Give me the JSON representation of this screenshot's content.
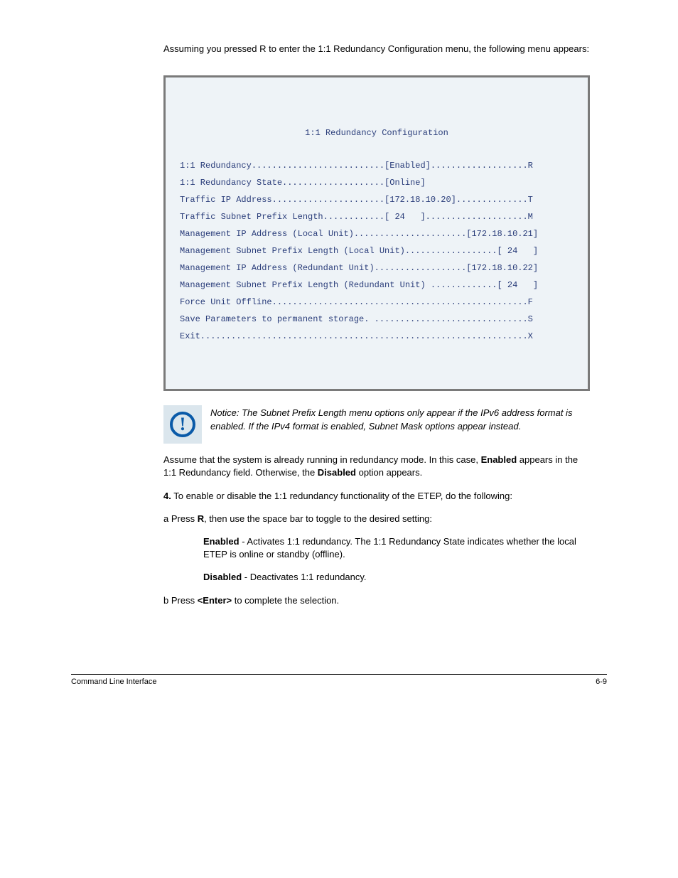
{
  "headerNote": "Assuming you pressed R to enter the 1:1 Redundancy Configuration menu, the following menu appears:",
  "config": {
    "title": "1:1 Redundancy Configuration",
    "lines": [
      "1:1 Redundancy..........................[Enabled]...................R",
      "1:1 Redundancy State....................[Online]",
      "Traffic IP Address......................[172.18.10.20]..............T",
      "Traffic Subnet Prefix Length............[ 24   ]....................M",
      "Management IP Address (Local Unit)......................[172.18.10.21]",
      "Management Subnet Prefix Length (Local Unit)..................[ 24   ]",
      "Management IP Address (Redundant Unit)..................[172.18.10.22]",
      "Management Subnet Prefix Length (Redundant Unit) .............[ 24   ]",
      "Force Unit Offline..................................................F",
      "",
      "Save Parameters to permanent storage. ..............................S",
      "Exit................................................................X"
    ]
  },
  "notice": "Notice: The Subnet Prefix Length menu options only appear if the IPv6 address format is enabled. If the IPv4 format is enabled, Subnet Mask options appear instead.",
  "body": {
    "p1a": "Assume that the system is already running in redundancy mode. In this case, ",
    "p1b": "Enabled",
    "p1c": " appears in the 1:1 Redundancy field. Otherwise, the ",
    "p1d": "Disabled",
    "p1e": " option appears.",
    "stepLabel": "4.",
    "stepText": "To enable or disable the 1:1 redundancy functionality of the ETEP, do the following:",
    "li_a_lead": "a  ",
    "li_a_pre": "Press ",
    "li_a_key": "R",
    "li_a_post": ", then use the space bar to toggle to the desired setting:",
    "li_enabled": "Enabled",
    "li_enabled_desc": " - Activates 1:1 redundancy. The 1:1 Redundancy State indicates whether the local ETEP is online or standby (offline).",
    "li_disabled": "Disabled",
    "li_disabled_desc": " - Deactivates 1:1 redundancy.",
    "li_b_lead": "b  ",
    "li_b_pre": "Press ",
    "li_b_key": "<Enter>",
    "li_b_post": " to complete the selection."
  },
  "footer": {
    "left": "Command Line Interface",
    "right": "6-9"
  }
}
